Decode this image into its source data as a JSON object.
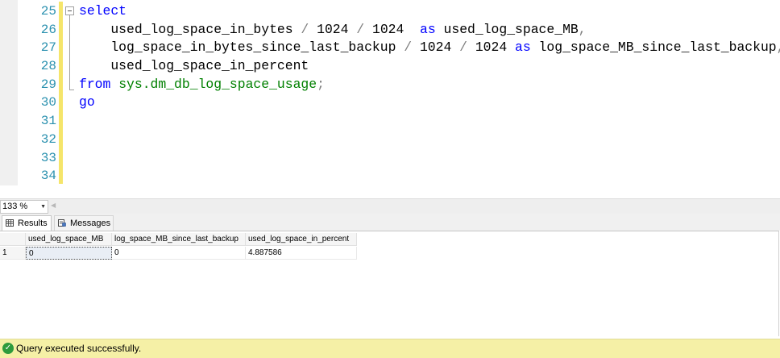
{
  "editor": {
    "line_numbers": [
      "25",
      "26",
      "27",
      "28",
      "29",
      "30",
      "31",
      "32",
      "33",
      "34"
    ],
    "lines": [
      [
        {
          "t": "select",
          "c": "kw"
        }
      ],
      [
        {
          "t": "    used_log_space_in_bytes ",
          "c": ""
        },
        {
          "t": "/",
          "c": "op"
        },
        {
          "t": " 1024 ",
          "c": ""
        },
        {
          "t": "/",
          "c": "op"
        },
        {
          "t": " 1024  ",
          "c": ""
        },
        {
          "t": "as",
          "c": "kw"
        },
        {
          "t": " used_log_space_MB",
          "c": ""
        },
        {
          "t": ",",
          "c": "op"
        }
      ],
      [
        {
          "t": "    log_space_in_bytes_since_last_backup ",
          "c": ""
        },
        {
          "t": "/",
          "c": "op"
        },
        {
          "t": " 1024 ",
          "c": ""
        },
        {
          "t": "/",
          "c": "op"
        },
        {
          "t": " 1024 ",
          "c": ""
        },
        {
          "t": "as",
          "c": "kw"
        },
        {
          "t": " log_space_MB_since_last_backup",
          "c": ""
        },
        {
          "t": ",",
          "c": "op"
        }
      ],
      [
        {
          "t": "    used_log_space_in_percent",
          "c": ""
        }
      ],
      [
        {
          "t": "from",
          "c": "kw"
        },
        {
          "t": " ",
          "c": ""
        },
        {
          "t": "sys.dm_db_log_space_usage",
          "c": "sys"
        },
        {
          "t": ";",
          "c": "op"
        }
      ],
      [
        {
          "t": "go",
          "c": "kw"
        }
      ],
      [],
      [],
      [],
      []
    ]
  },
  "zoom": {
    "value": "133 %",
    "arrow_icon": "dropdown-arrow-icon"
  },
  "tabs": {
    "results_label": "Results",
    "messages_label": "Messages"
  },
  "grid": {
    "columns": [
      "used_log_space_MB",
      "log_space_MB_since_last_backup",
      "used_log_space_in_percent"
    ],
    "rows": [
      {
        "row_number": "1",
        "cells": [
          "0",
          "0",
          "4.887586"
        ]
      }
    ]
  },
  "status": {
    "text": "Query executed successfully.",
    "color": "#f5f0a6",
    "icon": "check-circle-icon"
  }
}
